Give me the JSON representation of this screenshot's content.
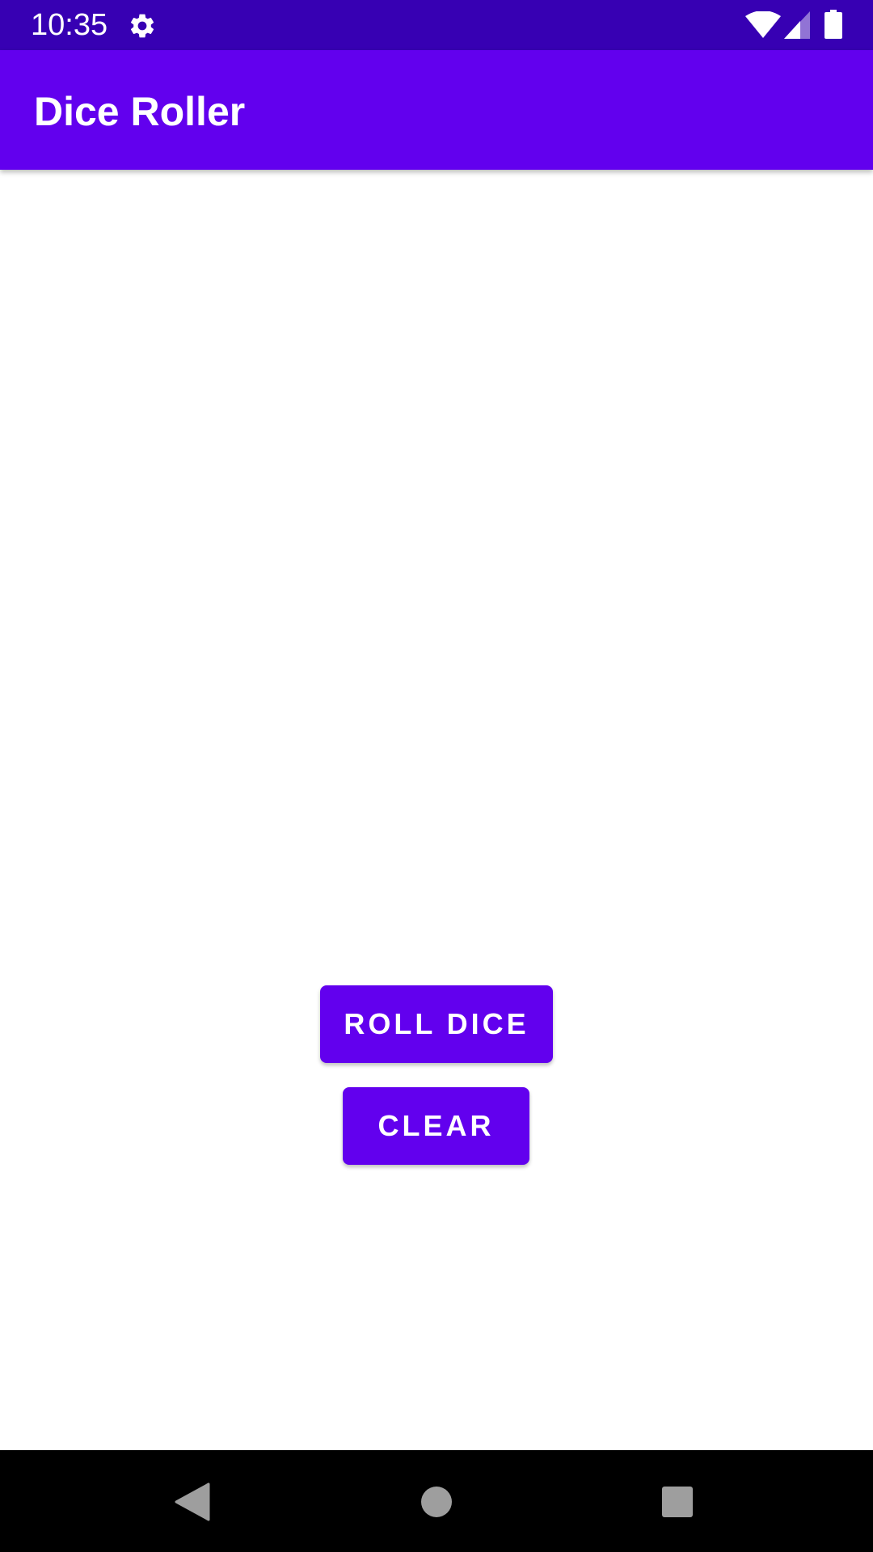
{
  "status_bar": {
    "time": "10:35",
    "icons": [
      "gear-icon",
      "wifi-icon",
      "cell-signal-icon",
      "battery-icon"
    ]
  },
  "app_bar": {
    "title": "Dice Roller"
  },
  "main": {
    "roll_button_label": "ROLL DICE",
    "clear_button_label": "CLEAR"
  },
  "nav_bar": {
    "icons": [
      "back-icon",
      "home-icon",
      "recents-icon"
    ]
  },
  "colors": {
    "status_bar": "#3700b3",
    "primary": "#6200ee",
    "background": "#ffffff",
    "nav_bar": "#000000"
  }
}
